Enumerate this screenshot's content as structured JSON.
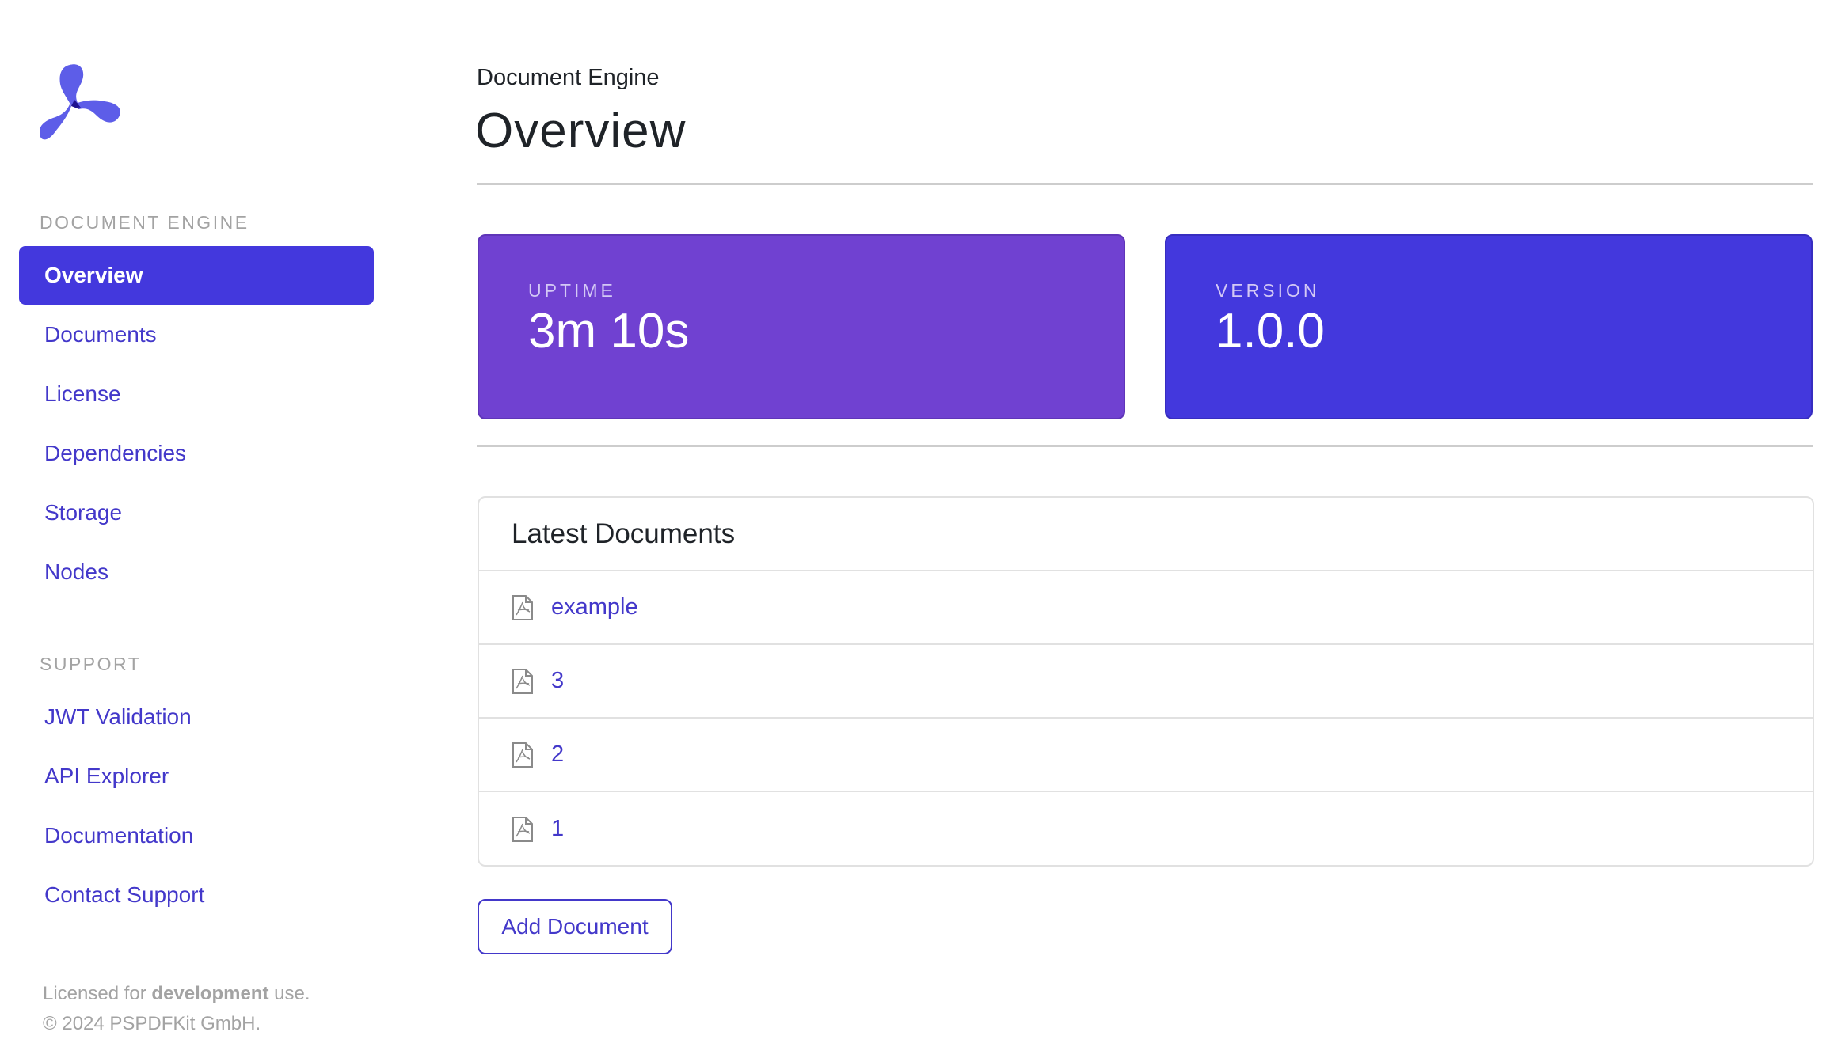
{
  "brand": {
    "logo_icon": "pspdfkit-logo-icon",
    "accent": "#4338dd",
    "uptime_color": "#7041d1"
  },
  "sidebar": {
    "sections": [
      {
        "label": "Document Engine",
        "items": [
          {
            "label": "Overview",
            "active": true
          },
          {
            "label": "Documents"
          },
          {
            "label": "License"
          },
          {
            "label": "Dependencies"
          },
          {
            "label": "Storage"
          },
          {
            "label": "Nodes"
          }
        ]
      },
      {
        "label": "Support",
        "items": [
          {
            "label": "JWT Validation"
          },
          {
            "label": "API Explorer"
          },
          {
            "label": "Documentation"
          },
          {
            "label": "Contact Support"
          }
        ]
      }
    ],
    "footer": {
      "license_prefix": "Licensed for ",
      "license_mode": "development",
      "license_suffix": " use.",
      "copyright": "© 2024 PSPDFKit GmbH."
    }
  },
  "header": {
    "eyebrow": "Document Engine",
    "title": "Overview"
  },
  "stats": {
    "uptime": {
      "label": "Uptime",
      "value": "3m 10s"
    },
    "version": {
      "label": "Version",
      "value": "1.0.0"
    }
  },
  "latest_documents": {
    "title": "Latest Documents",
    "icon": "pdf-file-icon",
    "items": [
      {
        "name": "example"
      },
      {
        "name": "3"
      },
      {
        "name": "2"
      },
      {
        "name": "1"
      }
    ]
  },
  "actions": {
    "add_document_label": "Add Document"
  }
}
